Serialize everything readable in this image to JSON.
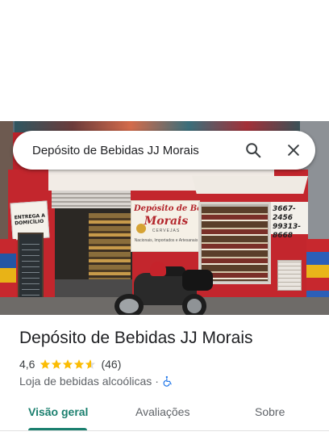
{
  "search": {
    "value": "Depósito de Bebidas JJ Morais",
    "search_icon": "search-icon",
    "close_icon": "close-icon"
  },
  "photo": {
    "storefront_sign": {
      "line1": "Depósito de Bebidas",
      "line2": "Morais",
      "line3": "CERVEJAS",
      "line4": "Nacionais, Importados e Artesanais"
    },
    "left_sign": "ENTREGA A DOMICÍLIO",
    "phone_sign": [
      "3667-2456",
      "99313-8668"
    ]
  },
  "place": {
    "title": "Depósito de Bebidas JJ Morais",
    "rating": "4,6",
    "rating_value": 4.6,
    "stars_max": 5,
    "review_count": "(46)",
    "category": "Loja de bebidas alcoólicas",
    "separator": "·",
    "accessibility_icon": "wheelchair-icon"
  },
  "tabs": [
    {
      "label": "Visão geral",
      "active": true
    },
    {
      "label": "Avaliações",
      "active": false
    },
    {
      "label": "Sobre",
      "active": false
    }
  ],
  "colors": {
    "accent": "#1a7f6e",
    "star": "#fbbc04",
    "accessibility": "#1a73e8"
  }
}
